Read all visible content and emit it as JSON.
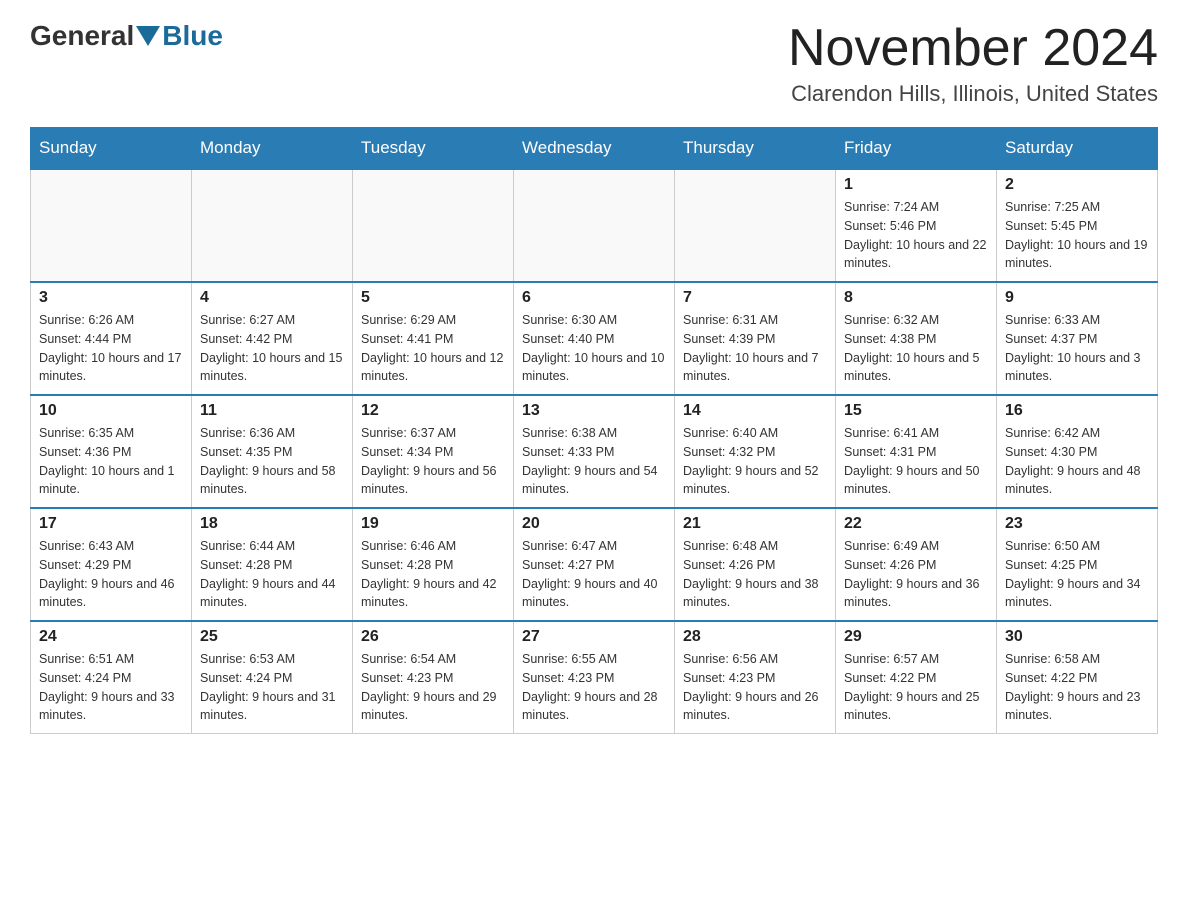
{
  "header": {
    "logo_general": "General",
    "logo_blue": "Blue",
    "month_title": "November 2024",
    "location": "Clarendon Hills, Illinois, United States"
  },
  "weekdays": [
    "Sunday",
    "Monday",
    "Tuesday",
    "Wednesday",
    "Thursday",
    "Friday",
    "Saturday"
  ],
  "weeks": [
    [
      {
        "day": "",
        "sunrise": "",
        "sunset": "",
        "daylight": ""
      },
      {
        "day": "",
        "sunrise": "",
        "sunset": "",
        "daylight": ""
      },
      {
        "day": "",
        "sunrise": "",
        "sunset": "",
        "daylight": ""
      },
      {
        "day": "",
        "sunrise": "",
        "sunset": "",
        "daylight": ""
      },
      {
        "day": "",
        "sunrise": "",
        "sunset": "",
        "daylight": ""
      },
      {
        "day": "1",
        "sunrise": "Sunrise: 7:24 AM",
        "sunset": "Sunset: 5:46 PM",
        "daylight": "Daylight: 10 hours and 22 minutes."
      },
      {
        "day": "2",
        "sunrise": "Sunrise: 7:25 AM",
        "sunset": "Sunset: 5:45 PM",
        "daylight": "Daylight: 10 hours and 19 minutes."
      }
    ],
    [
      {
        "day": "3",
        "sunrise": "Sunrise: 6:26 AM",
        "sunset": "Sunset: 4:44 PM",
        "daylight": "Daylight: 10 hours and 17 minutes."
      },
      {
        "day": "4",
        "sunrise": "Sunrise: 6:27 AM",
        "sunset": "Sunset: 4:42 PM",
        "daylight": "Daylight: 10 hours and 15 minutes."
      },
      {
        "day": "5",
        "sunrise": "Sunrise: 6:29 AM",
        "sunset": "Sunset: 4:41 PM",
        "daylight": "Daylight: 10 hours and 12 minutes."
      },
      {
        "day": "6",
        "sunrise": "Sunrise: 6:30 AM",
        "sunset": "Sunset: 4:40 PM",
        "daylight": "Daylight: 10 hours and 10 minutes."
      },
      {
        "day": "7",
        "sunrise": "Sunrise: 6:31 AM",
        "sunset": "Sunset: 4:39 PM",
        "daylight": "Daylight: 10 hours and 7 minutes."
      },
      {
        "day": "8",
        "sunrise": "Sunrise: 6:32 AM",
        "sunset": "Sunset: 4:38 PM",
        "daylight": "Daylight: 10 hours and 5 minutes."
      },
      {
        "day": "9",
        "sunrise": "Sunrise: 6:33 AM",
        "sunset": "Sunset: 4:37 PM",
        "daylight": "Daylight: 10 hours and 3 minutes."
      }
    ],
    [
      {
        "day": "10",
        "sunrise": "Sunrise: 6:35 AM",
        "sunset": "Sunset: 4:36 PM",
        "daylight": "Daylight: 10 hours and 1 minute."
      },
      {
        "day": "11",
        "sunrise": "Sunrise: 6:36 AM",
        "sunset": "Sunset: 4:35 PM",
        "daylight": "Daylight: 9 hours and 58 minutes."
      },
      {
        "day": "12",
        "sunrise": "Sunrise: 6:37 AM",
        "sunset": "Sunset: 4:34 PM",
        "daylight": "Daylight: 9 hours and 56 minutes."
      },
      {
        "day": "13",
        "sunrise": "Sunrise: 6:38 AM",
        "sunset": "Sunset: 4:33 PM",
        "daylight": "Daylight: 9 hours and 54 minutes."
      },
      {
        "day": "14",
        "sunrise": "Sunrise: 6:40 AM",
        "sunset": "Sunset: 4:32 PM",
        "daylight": "Daylight: 9 hours and 52 minutes."
      },
      {
        "day": "15",
        "sunrise": "Sunrise: 6:41 AM",
        "sunset": "Sunset: 4:31 PM",
        "daylight": "Daylight: 9 hours and 50 minutes."
      },
      {
        "day": "16",
        "sunrise": "Sunrise: 6:42 AM",
        "sunset": "Sunset: 4:30 PM",
        "daylight": "Daylight: 9 hours and 48 minutes."
      }
    ],
    [
      {
        "day": "17",
        "sunrise": "Sunrise: 6:43 AM",
        "sunset": "Sunset: 4:29 PM",
        "daylight": "Daylight: 9 hours and 46 minutes."
      },
      {
        "day": "18",
        "sunrise": "Sunrise: 6:44 AM",
        "sunset": "Sunset: 4:28 PM",
        "daylight": "Daylight: 9 hours and 44 minutes."
      },
      {
        "day": "19",
        "sunrise": "Sunrise: 6:46 AM",
        "sunset": "Sunset: 4:28 PM",
        "daylight": "Daylight: 9 hours and 42 minutes."
      },
      {
        "day": "20",
        "sunrise": "Sunrise: 6:47 AM",
        "sunset": "Sunset: 4:27 PM",
        "daylight": "Daylight: 9 hours and 40 minutes."
      },
      {
        "day": "21",
        "sunrise": "Sunrise: 6:48 AM",
        "sunset": "Sunset: 4:26 PM",
        "daylight": "Daylight: 9 hours and 38 minutes."
      },
      {
        "day": "22",
        "sunrise": "Sunrise: 6:49 AM",
        "sunset": "Sunset: 4:26 PM",
        "daylight": "Daylight: 9 hours and 36 minutes."
      },
      {
        "day": "23",
        "sunrise": "Sunrise: 6:50 AM",
        "sunset": "Sunset: 4:25 PM",
        "daylight": "Daylight: 9 hours and 34 minutes."
      }
    ],
    [
      {
        "day": "24",
        "sunrise": "Sunrise: 6:51 AM",
        "sunset": "Sunset: 4:24 PM",
        "daylight": "Daylight: 9 hours and 33 minutes."
      },
      {
        "day": "25",
        "sunrise": "Sunrise: 6:53 AM",
        "sunset": "Sunset: 4:24 PM",
        "daylight": "Daylight: 9 hours and 31 minutes."
      },
      {
        "day": "26",
        "sunrise": "Sunrise: 6:54 AM",
        "sunset": "Sunset: 4:23 PM",
        "daylight": "Daylight: 9 hours and 29 minutes."
      },
      {
        "day": "27",
        "sunrise": "Sunrise: 6:55 AM",
        "sunset": "Sunset: 4:23 PM",
        "daylight": "Daylight: 9 hours and 28 minutes."
      },
      {
        "day": "28",
        "sunrise": "Sunrise: 6:56 AM",
        "sunset": "Sunset: 4:23 PM",
        "daylight": "Daylight: 9 hours and 26 minutes."
      },
      {
        "day": "29",
        "sunrise": "Sunrise: 6:57 AM",
        "sunset": "Sunset: 4:22 PM",
        "daylight": "Daylight: 9 hours and 25 minutes."
      },
      {
        "day": "30",
        "sunrise": "Sunrise: 6:58 AM",
        "sunset": "Sunset: 4:22 PM",
        "daylight": "Daylight: 9 hours and 23 minutes."
      }
    ]
  ]
}
